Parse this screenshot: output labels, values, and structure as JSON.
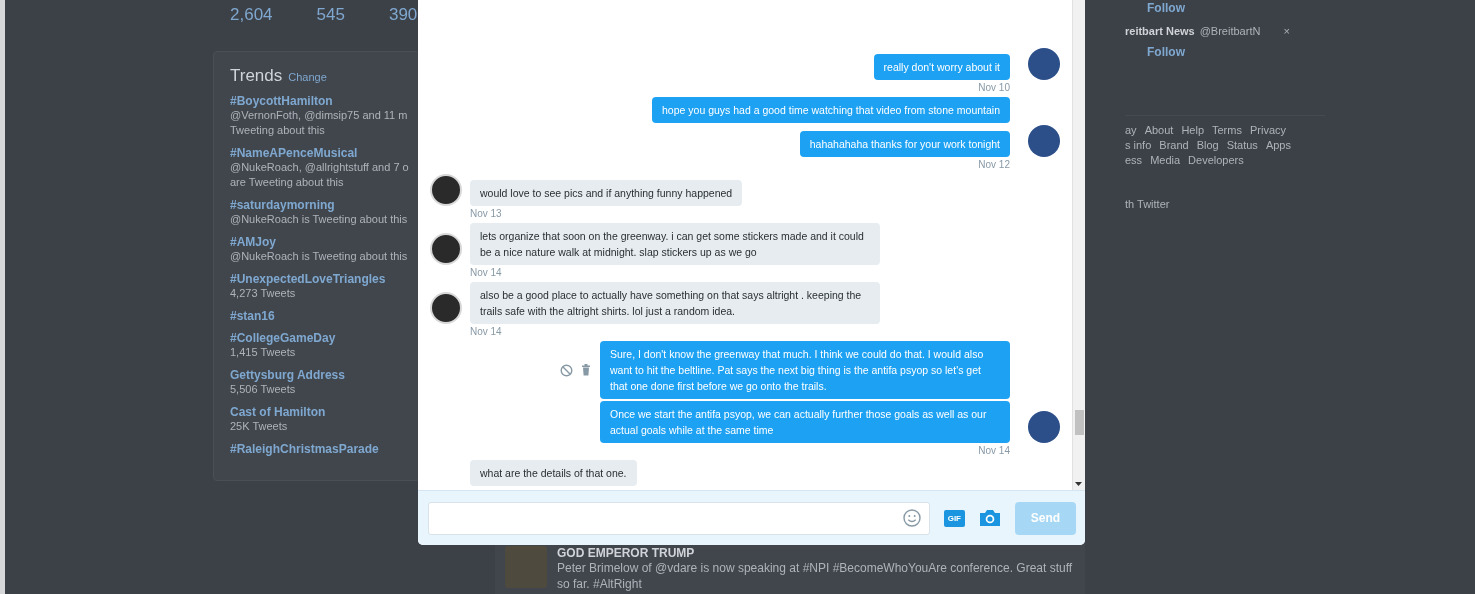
{
  "profile_stats": [
    "2,604",
    "545",
    "390"
  ],
  "trends": {
    "title": "Trends",
    "change_link": "Change",
    "items": [
      {
        "name": "#BoycottHamilton",
        "lines": [
          "@VernonFoth, @dimsip75 and 11 m",
          "Tweeting about this"
        ]
      },
      {
        "name": "#NameAPenceMusical",
        "lines": [
          "@NukeRoach, @allrightstuff and 7 o",
          "are Tweeting about this"
        ]
      },
      {
        "name": "#saturdaymorning",
        "lines": [
          "@NukeRoach is Tweeting about this"
        ]
      },
      {
        "name": "#AMJoy",
        "lines": [
          "@NukeRoach is Tweeting about this"
        ]
      },
      {
        "name": "#UnexpectedLoveTriangles",
        "lines": [
          "4,273 Tweets"
        ]
      },
      {
        "name": "#stan16"
      },
      {
        "name": "#CollegeGameDay",
        "lines": [
          "1,415 Tweets"
        ]
      },
      {
        "name": "Gettysburg Address",
        "lines": [
          "5,506 Tweets"
        ]
      },
      {
        "name": "Cast of Hamilton",
        "lines": [
          "25K Tweets"
        ]
      },
      {
        "name": "#RaleighChristmasParade"
      }
    ]
  },
  "timeline_tweet": {
    "name": "GOD EMPEROR TRUMP",
    "text": "Peter Brimelow of @vdare is now speaking at #NPI #BecomeWhoYouAre conference. Great stuff so far. #AltRight"
  },
  "right_column": {
    "follow_labels": [
      "Follow",
      "Follow"
    ],
    "account_name": "reitbart News",
    "account_handle": "@BreitbartN",
    "close_mark": "×",
    "footer_lines": [
      [
        "ay",
        "About",
        "Help",
        "Terms",
        "Privacy"
      ],
      [
        "s info",
        "Brand",
        "Blog",
        "Status",
        "Apps"
      ],
      [
        "ess",
        "Media",
        "Developers"
      ]
    ],
    "bottom_text": "th Twitter"
  },
  "messages": [
    {
      "kind": "sent",
      "text": "really don't worry about it",
      "time": "Nov 10",
      "avatar": true,
      "actions": false
    },
    {
      "kind": "sent",
      "text": "hope you guys had a good time watching that video from stone mountain",
      "avatar": false,
      "actions": false
    },
    {
      "kind": "sent",
      "text": "hahahahaha thanks for your work tonight",
      "time": "Nov 12",
      "avatar": true,
      "actions": false
    },
    {
      "kind": "received",
      "text": "would love to see pics and if anything funny happened",
      "time": "Nov 13",
      "avatar": true,
      "actions": false
    },
    {
      "kind": "received",
      "text": "lets organize that soon on the greenway. i can get some stickers made and it could be a nice nature walk at midnight. slap stickers up as we go",
      "time": "Nov 14",
      "avatar": true,
      "actions": false
    },
    {
      "kind": "received",
      "text": "also be a good place to actually have something on that says altright . keeping the trails safe with the altright shirts. lol just a random idea.",
      "time": "Nov 14",
      "avatar": true,
      "actions": false
    },
    {
      "kind": "sent",
      "text": "Sure, I don't know the greenway that much. I think we could do that. I would also want to hit the beltline. Pat says the next big thing is the antifa psyop so let's get that one done first before we go onto the trails.",
      "avatar": false,
      "actions": true
    },
    {
      "kind": "sent",
      "text": "Once we start the antifa psyop, we can actually further those goals as well as our actual goals while at the same time",
      "time": "Nov 14",
      "avatar": true,
      "actions": false
    },
    {
      "kind": "received",
      "text": "what are the details of that one.",
      "avatar": false,
      "actions": false
    }
  ],
  "composer": {
    "gif_label": "GIF",
    "send_label": "Send",
    "send_disabled": true
  }
}
